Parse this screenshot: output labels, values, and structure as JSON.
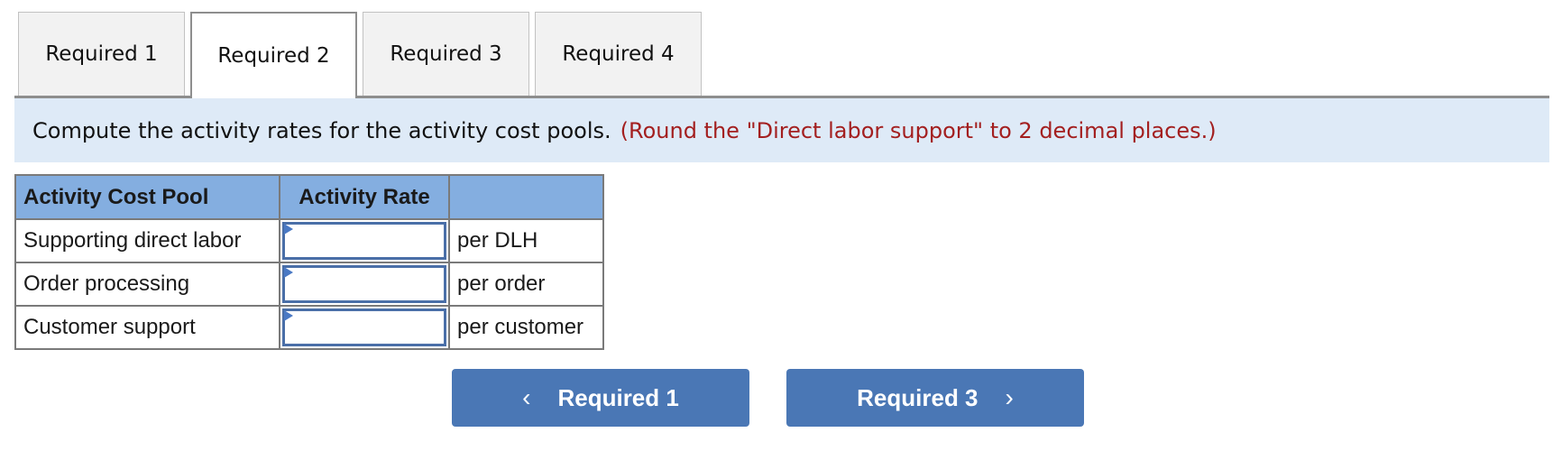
{
  "tabs": [
    {
      "label": "Required 1",
      "active": false
    },
    {
      "label": "Required 2",
      "active": true
    },
    {
      "label": "Required 3",
      "active": false
    },
    {
      "label": "Required 4",
      "active": false
    }
  ],
  "instruction": {
    "text": "Compute the activity rates for the activity cost pools.",
    "hint": "(Round the \"Direct labor support\" to 2 decimal places.)"
  },
  "table": {
    "headers": [
      "Activity Cost Pool",
      "Activity Rate",
      ""
    ],
    "rows": [
      {
        "pool": "Supporting direct labor",
        "rate": "",
        "unit": "per DLH"
      },
      {
        "pool": "Order processing",
        "rate": "",
        "unit": "per order"
      },
      {
        "pool": "Customer support",
        "rate": "",
        "unit": "per customer"
      }
    ]
  },
  "nav": {
    "prev_label": "Required 1",
    "prev_icon": "chevron-left-icon",
    "next_label": "Required 3",
    "next_icon": "chevron-right-icon"
  },
  "colors": {
    "header_bg": "#84aee0",
    "band_bg": "#deeaf7",
    "hint_text": "#a31f1f",
    "button_bg": "#4a77b5"
  }
}
